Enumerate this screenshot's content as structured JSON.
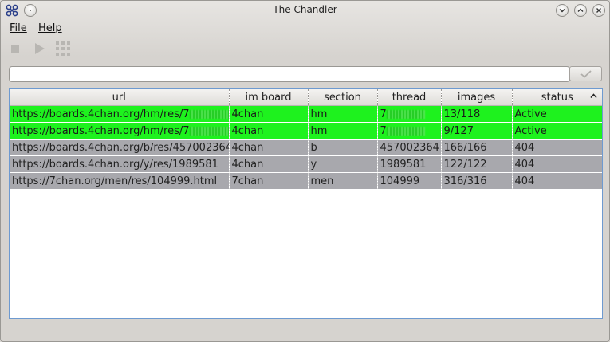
{
  "window": {
    "title": "The Chandler"
  },
  "menu": {
    "file": "File",
    "help": "Help"
  },
  "toolbar": {
    "stop_icon": "stop-icon",
    "play_icon": "play-icon",
    "grid_icon": "grid-icon"
  },
  "url_input": {
    "value": "",
    "placeholder": ""
  },
  "ok_button": {
    "icon": "checkmark-icon"
  },
  "table": {
    "columns": [
      "url",
      "im board",
      "section",
      "thread",
      "images",
      "status"
    ],
    "sort_column": "status",
    "sort_direction": "ascending",
    "rows": [
      {
        "url": "https://boards.4chan.org/hm/res/7",
        "board": "4chan",
        "section": "hm",
        "thread": "7",
        "images": "13/118",
        "status": "Active",
        "state": "active"
      },
      {
        "url": "https://boards.4chan.org/hm/res/7",
        "board": "4chan",
        "section": "hm",
        "thread": "7",
        "images": "9/127",
        "status": "Active",
        "state": "active"
      },
      {
        "url": "https://boards.4chan.org/b/res/457002364",
        "board": "4chan",
        "section": "b",
        "thread": "457002364",
        "images": "166/166",
        "status": "404",
        "state": "dead"
      },
      {
        "url": "https://boards.4chan.org/y/res/1989581",
        "board": "4chan",
        "section": "y",
        "thread": "1989581",
        "images": "122/122",
        "status": "404",
        "state": "dead"
      },
      {
        "url": "https://7chan.org/men/res/104999.html",
        "board": "7chan",
        "section": "men",
        "thread": "104999",
        "images": "316/316",
        "status": "404",
        "state": "dead"
      }
    ]
  },
  "colors": {
    "active_row": "#1ef21e",
    "dead_row": "#a8a8ad",
    "selection_border": "#6e9ad0"
  }
}
